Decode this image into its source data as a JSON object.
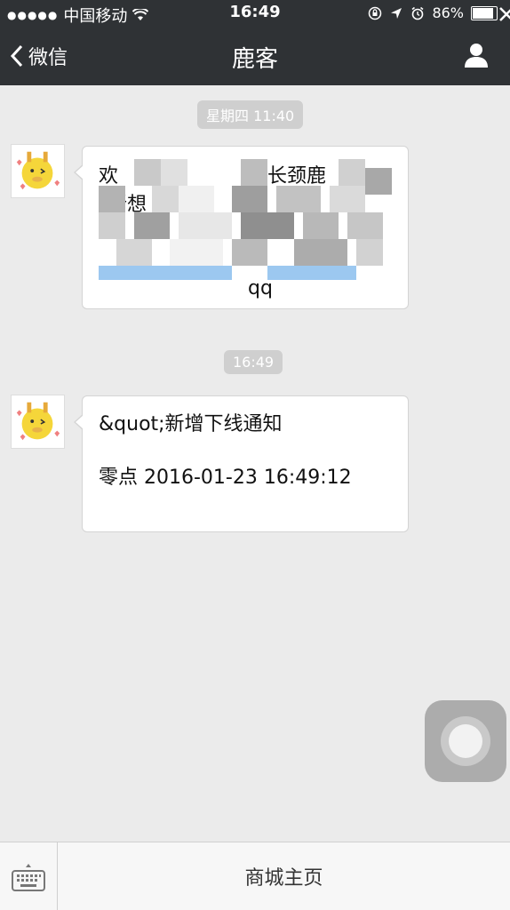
{
  "status_bar": {
    "signal_dots": "●●●●●",
    "carrier": "中国移动",
    "time": "16:49",
    "battery": "86%"
  },
  "nav": {
    "back_label": "微信",
    "title": "鹿客",
    "icons": [
      "chevron-left-icon",
      "user-icon"
    ]
  },
  "chat": {
    "messages": [
      {
        "timestamp": "星期四 11:40",
        "text_visible": [
          "欢",
          "长颈鹿",
          "新想",
          "qq"
        ],
        "redacted": true
      },
      {
        "timestamp": "16:49",
        "line1": "&quot;新增下线通知",
        "line2": "零点 2016-01-23 16:49:12"
      }
    ]
  },
  "bottom_bar": {
    "menu_label": "商城主页",
    "icons": [
      "keyboard-icon"
    ]
  },
  "colors": {
    "nav_bg": "#2f3235",
    "chat_bg": "#ebebeb",
    "link": "#3a8fe0"
  }
}
